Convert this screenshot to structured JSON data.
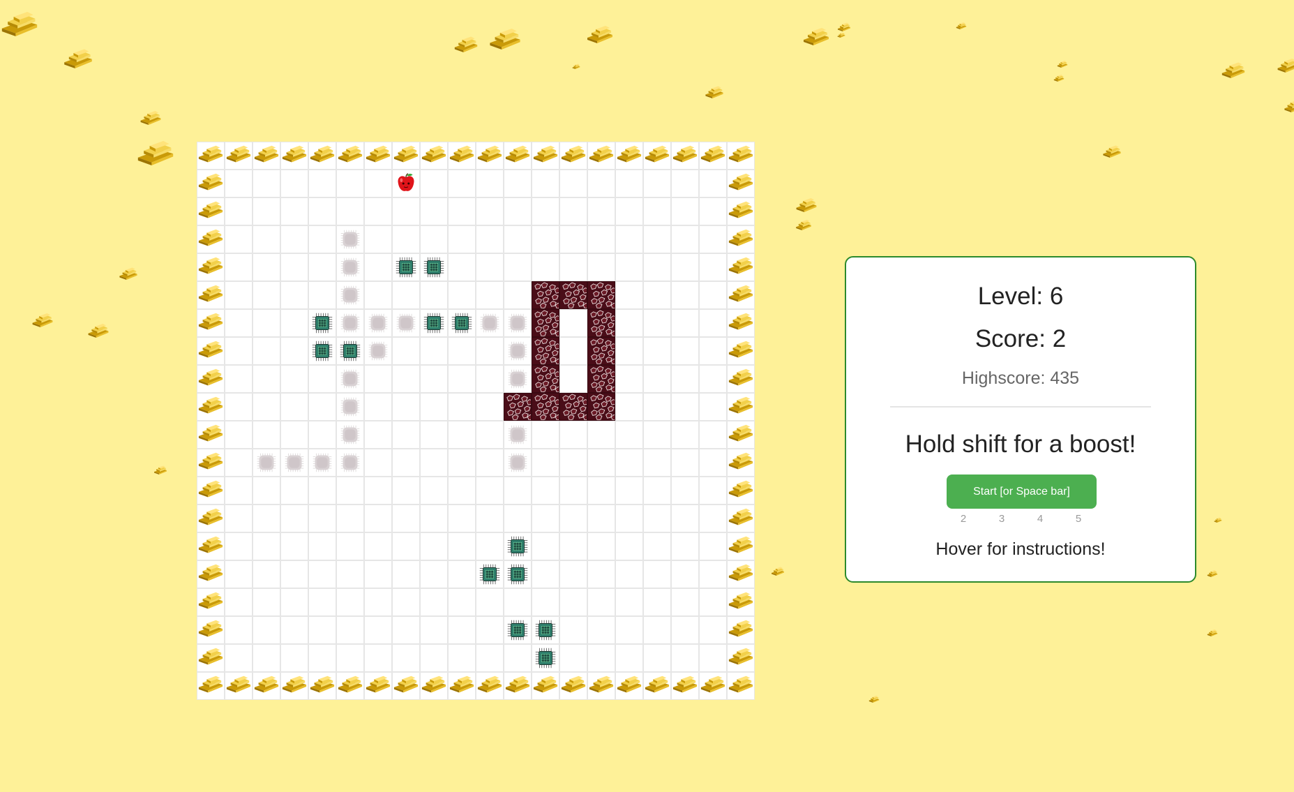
{
  "panel": {
    "level_label": "Level: 6",
    "score_label": "Score: 2",
    "highscore_label": "Highscore: 435",
    "boost_hint": "Hold shift for a boost!",
    "start_label": "Start [or Space bar]",
    "speed_options": [
      "2",
      "3",
      "4",
      "5"
    ],
    "instructions_label": "Hover for instructions!"
  },
  "board": {
    "columns": 20,
    "rows": 20,
    "apple": [
      7,
      1
    ],
    "snake_segments": [
      [
        5,
        3
      ],
      [
        5,
        4
      ],
      [
        5,
        5
      ],
      [
        5,
        6
      ],
      [
        6,
        6
      ],
      [
        7,
        6
      ],
      [
        10,
        6
      ],
      [
        11,
        6
      ],
      [
        11,
        7
      ],
      [
        6,
        7
      ],
      [
        5,
        8
      ],
      [
        5,
        9
      ],
      [
        5,
        10
      ],
      [
        5,
        11
      ],
      [
        4,
        11
      ],
      [
        3,
        11
      ],
      [
        2,
        11
      ],
      [
        11,
        8
      ],
      [
        11,
        10
      ],
      [
        11,
        11
      ]
    ],
    "chips": [
      [
        7,
        4
      ],
      [
        8,
        4
      ],
      [
        4,
        6
      ],
      [
        8,
        6
      ],
      [
        9,
        6
      ],
      [
        4,
        7
      ],
      [
        5,
        7
      ],
      [
        11,
        14
      ],
      [
        10,
        15
      ],
      [
        11,
        15
      ],
      [
        11,
        17
      ],
      [
        12,
        17
      ],
      [
        12,
        18
      ]
    ],
    "obstacles": [
      [
        12,
        5
      ],
      [
        13,
        5
      ],
      [
        14,
        5
      ],
      [
        12,
        6
      ],
      [
        14,
        6
      ],
      [
        12,
        7
      ],
      [
        14,
        7
      ],
      [
        12,
        8
      ],
      [
        14,
        8
      ],
      [
        11,
        9
      ],
      [
        12,
        9
      ],
      [
        13,
        9
      ],
      [
        14,
        9
      ]
    ]
  },
  "colors": {
    "background": "#FEF198",
    "panel_border": "#2c8a2c",
    "start_button": "#4CAF50",
    "obstacle": "#4a0d18",
    "chip": "#2e7d6b",
    "apple": "#e0141a"
  },
  "icons": {
    "wall": "gold-bars-icon",
    "chip": "microchip-icon",
    "snake": "chip-ghost-icon",
    "apple": "apple-icon",
    "obstacle": "cracked-rock-icon"
  }
}
